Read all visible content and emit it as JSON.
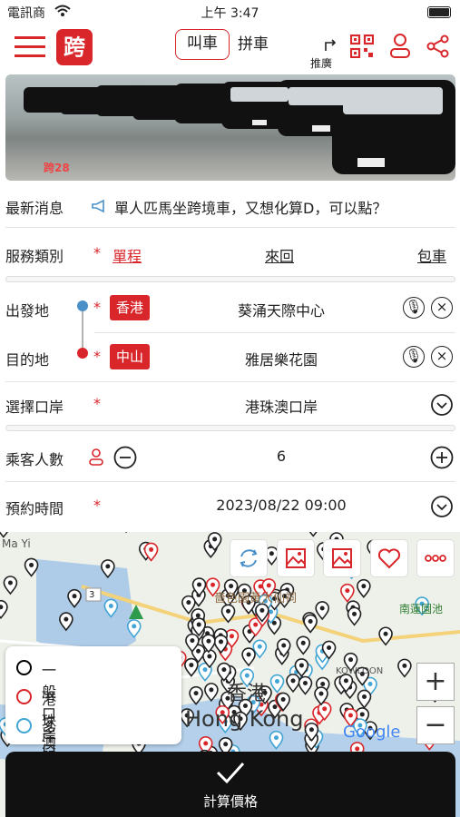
{
  "status": {
    "carrier": "電訊商",
    "time": "上午 3:47"
  },
  "header": {
    "logo_char": "跨",
    "tab_call": "叫車",
    "tab_carpool": "拼車",
    "recommend": "推廣"
  },
  "banner": {
    "brand": "跨28"
  },
  "news": {
    "label": "最新消息",
    "text": "單人匹馬坐跨境車，又想化算D，可以點？"
  },
  "service": {
    "label": "服務類別",
    "options": [
      "單程",
      "來回",
      "包車"
    ],
    "selected": "單程"
  },
  "departure": {
    "label": "出發地",
    "region": "香港",
    "value": "葵涌天際中心"
  },
  "destination": {
    "label": "目的地",
    "region": "中山",
    "value": "雅居樂花園"
  },
  "port": {
    "label": "選擇口岸",
    "value": "港珠澳口岸"
  },
  "passengers": {
    "label": "乘客人數",
    "value": "6"
  },
  "booking": {
    "label": "預約時間",
    "value": "2023/08/22 09:00"
  },
  "map": {
    "place_label": "嗇色園黃大仙祠",
    "city_zh": "香港",
    "city_en": "Hong Kong",
    "google": "Google",
    "east": "南蓮園池",
    "kowloon": "KOWLOON",
    "road": "3",
    "road2": "Ma Yi"
  },
  "legend": [
    {
      "label": "一般口岸服務",
      "color": "#000000"
    },
    {
      "label": "港珠澳服務",
      "color": "#d8262a"
    },
    {
      "label": "多口岸服務",
      "color": "#42a5d5"
    }
  ],
  "calculate": {
    "label": "計算價格"
  },
  "colors": {
    "accent": "#d8262a"
  }
}
